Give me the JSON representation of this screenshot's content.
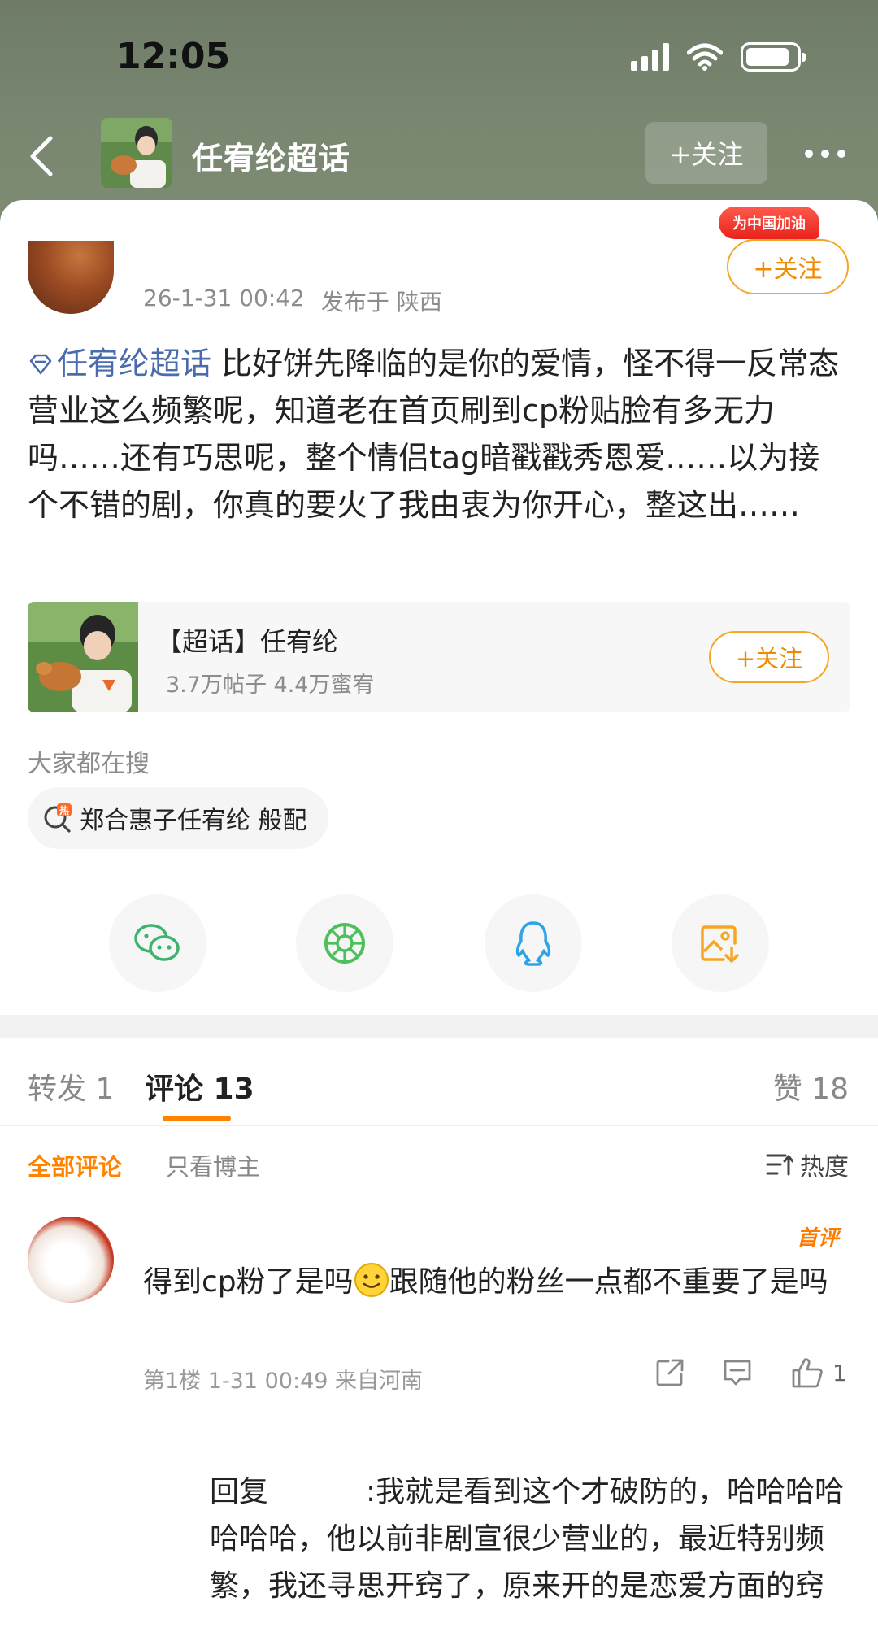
{
  "status_bar": {
    "time": "12:05"
  },
  "nav": {
    "title": "任宥纶超话",
    "follow_label": "+关注"
  },
  "post": {
    "promo_badge": "为中国加油",
    "follow_label": "+关注",
    "meta_time": "26-1-31 00:42",
    "meta_location": "发布于 陕西",
    "topic_link": "任宥纶超话",
    "body": " 比好饼先降临的是你的爱情，怪不得一反常态营业这么频繁呢，知道老在首页刷到cp粉贴脸有多无力吗……还有巧思呢，整个情侣tag暗戳戳秀恩爱……以为接个不错的剧，你真的要火了我由衷为你开心，整这出……"
  },
  "topic_card": {
    "name": "【超话】任宥纶",
    "stats": "3.7万帖子 4.4万蜜宥",
    "follow_label": "+关注"
  },
  "search": {
    "title": "大家都在搜",
    "chip": "郑合惠子任宥纶 般配"
  },
  "share": {
    "icons": [
      "wechat-icon",
      "moments-icon",
      "qq-icon",
      "save-image-icon"
    ]
  },
  "tabs": {
    "repost": "转发 1",
    "comments": "评论 13",
    "likes": "赞 18"
  },
  "filter": {
    "all": "全部评论",
    "owner_only": "只看博主",
    "sort": "热度"
  },
  "comment": {
    "badge": "首评",
    "text_a": "得到cp粉了是吗",
    "text_b": "跟随他的粉丝一点都不重要了是吗",
    "meta": "第1楼 1-31 00:49 来自河南",
    "like_count": "1"
  },
  "reply": {
    "prefix": "回复",
    "text": ":我就是看到这个才破防的，哈哈哈哈哈哈哈，他以前非剧宣很少营业的，最近特别频繁，我还寻思开窍了，原来开的是恋爱方面的窍"
  },
  "colors": {
    "accent": "#ff8200",
    "link": "#4a6cae",
    "header_bg": "#778670"
  }
}
